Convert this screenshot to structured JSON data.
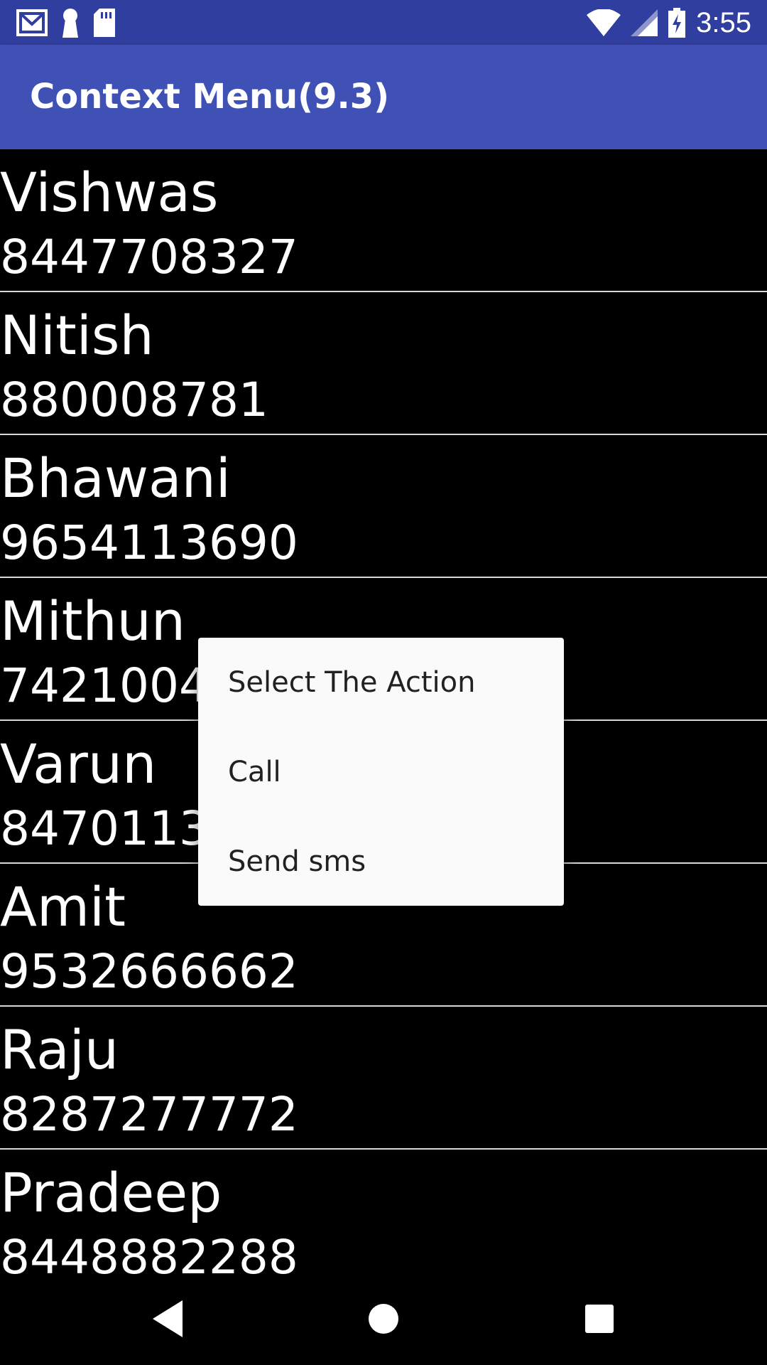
{
  "status_bar": {
    "time": "3:55",
    "left_icons": [
      "gmail-icon",
      "keyhole-icon",
      "sd-card-icon"
    ],
    "right_icons": [
      "wifi-icon",
      "cell-signal-icon",
      "battery-charging-icon"
    ]
  },
  "app_bar": {
    "title": "Context Menu(9.3)",
    "color": "#3F51B5",
    "status_color": "#303F9F"
  },
  "contacts": [
    {
      "name": "Vishwas",
      "number": "8447708327"
    },
    {
      "name": "Nitish",
      "number": "880008781"
    },
    {
      "name": "Bhawani",
      "number": "9654113690"
    },
    {
      "name": "Mithun",
      "number": "74210048"
    },
    {
      "name": "Varun",
      "number": "84701133"
    },
    {
      "name": "Amit",
      "number": "9532666662"
    },
    {
      "name": "Raju",
      "number": "8287277772"
    },
    {
      "name": "Pradeep",
      "number": "8448882288"
    }
  ],
  "context_menu": {
    "title": "Select The Action",
    "items": [
      {
        "label": "Call"
      },
      {
        "label": "Send sms"
      }
    ]
  },
  "nav_bar": {
    "icons": [
      "back-icon",
      "home-icon",
      "recents-icon"
    ]
  }
}
